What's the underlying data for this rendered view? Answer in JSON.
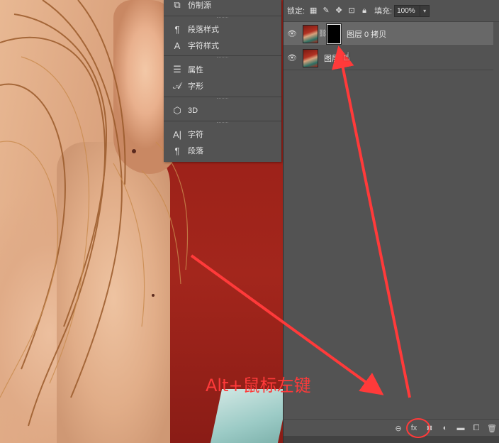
{
  "menu": {
    "items": [
      {
        "label": "仿制源",
        "icon": "clone-source-icon",
        "glyph": "⧉"
      },
      {
        "label": "段落样式",
        "icon": "paragraph-styles-icon",
        "glyph": "¶"
      },
      {
        "label": "字符样式",
        "icon": "character-styles-icon",
        "glyph": "A"
      },
      {
        "label": "属性",
        "icon": "properties-icon",
        "glyph": "☰"
      },
      {
        "label": "字形",
        "icon": "glyphs-icon",
        "glyph": "𝒜"
      },
      {
        "label": "3D",
        "icon": "cube-3d-icon",
        "glyph": "⬡"
      },
      {
        "label": "字符",
        "icon": "character-icon",
        "glyph": "A|"
      },
      {
        "label": "段落",
        "icon": "paragraph-icon",
        "glyph": "¶"
      }
    ]
  },
  "layers_panel": {
    "lock_label": "锁定:",
    "fill_label": "填充:",
    "fill_value": "100%",
    "layers": [
      {
        "name": "图层 0 拷贝",
        "selected": true,
        "has_mask": true
      },
      {
        "name": "图层",
        "selected": false,
        "has_mask": false
      }
    ],
    "footer": {
      "fx_label": "fx"
    }
  },
  "annotation": {
    "text": "Alt+鼠标左键",
    "color": "#ff3a3a"
  }
}
